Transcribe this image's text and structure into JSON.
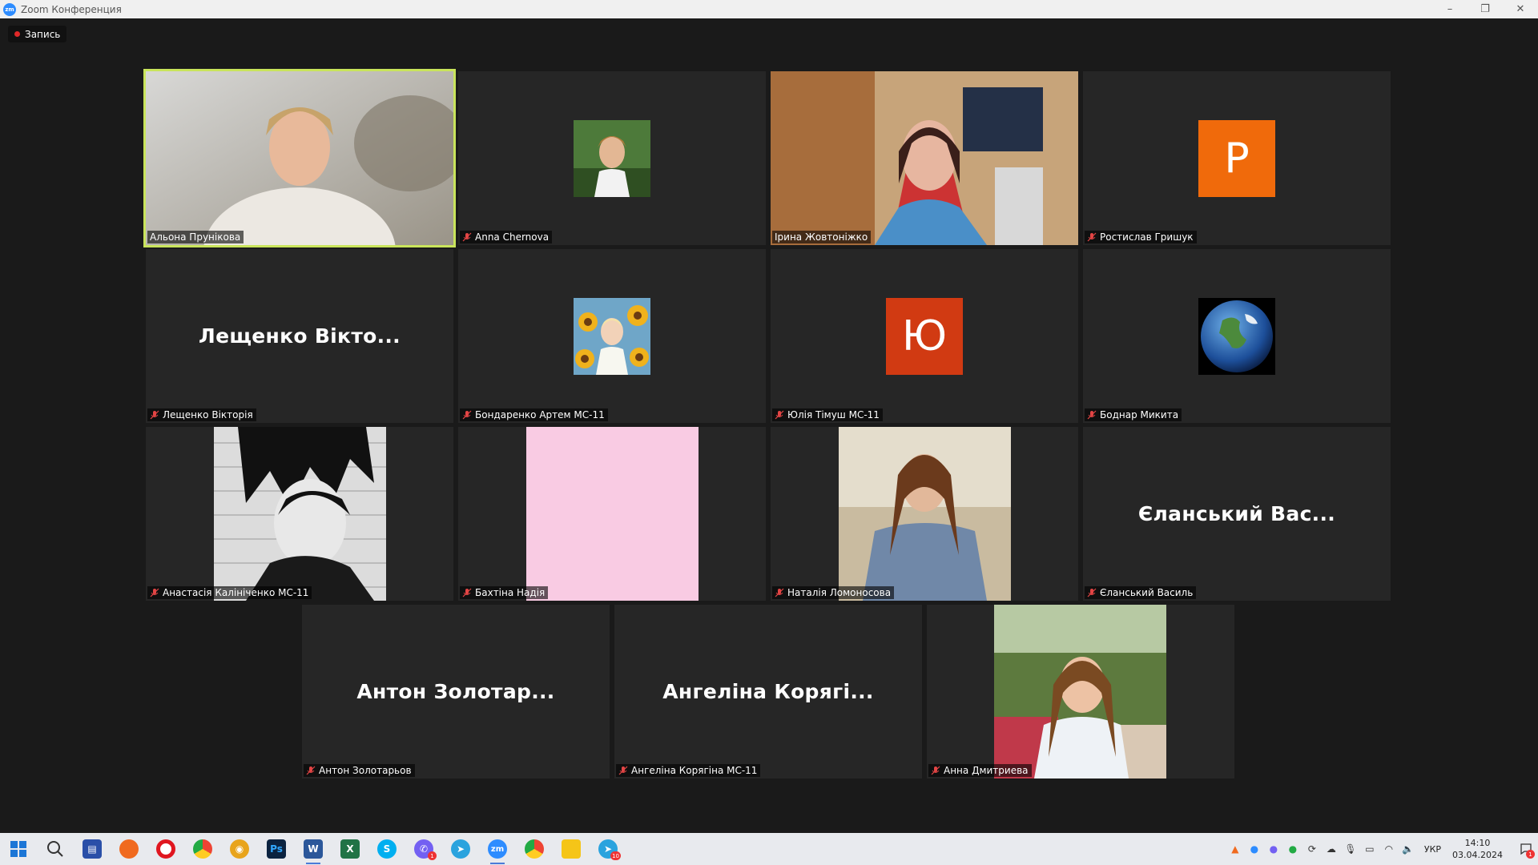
{
  "window": {
    "title": "Zoom Конференция",
    "logo_text": "zm",
    "controls": {
      "minimize": "–",
      "restore": "❐",
      "close": "✕"
    }
  },
  "recording": {
    "label": "Запись",
    "color": "#e02828"
  },
  "participants": [
    {
      "id": "p1",
      "name": "Альона Прунікова",
      "type": "video",
      "active": true,
      "muted": false
    },
    {
      "id": "p2",
      "name": "Anna Chernova",
      "type": "photo",
      "muted": true
    },
    {
      "id": "p3",
      "name": "Ірина Жовтоніжко",
      "type": "video",
      "muted": false
    },
    {
      "id": "p4",
      "name": "Ростислав Гришук",
      "type": "letter",
      "letter": "Р",
      "color": "#f06a0b",
      "muted": true
    },
    {
      "id": "p5",
      "name": "Лещенко Вікторія",
      "center_name": "Лещенко  Вікто...",
      "type": "name",
      "muted": true
    },
    {
      "id": "p6",
      "name": "Бондаренко Артем МС-11",
      "type": "photo",
      "muted": true
    },
    {
      "id": "p7",
      "name": "Юлія Тімуш МС-11",
      "type": "letter",
      "letter": "Ю",
      "color": "#d13a12",
      "muted": true
    },
    {
      "id": "p8",
      "name": "Боднар Микита",
      "type": "photo",
      "muted": true
    },
    {
      "id": "p9",
      "name": "Анастасія Калініченко МС-11",
      "type": "picture",
      "muted": true
    },
    {
      "id": "p10",
      "name": "Бахтіна Надія",
      "type": "picture",
      "color": "#f9cbe3",
      "muted": true
    },
    {
      "id": "p11",
      "name": "Наталія Ломоносова",
      "type": "picture",
      "muted": true
    },
    {
      "id": "p12",
      "name": "Єланський Василь",
      "center_name": "Єланський  Вас...",
      "type": "name",
      "muted": true
    },
    {
      "id": "p13",
      "name": "Антон Золотарьов",
      "center_name": "Антон  Золотар...",
      "type": "name",
      "muted": true
    },
    {
      "id": "p14",
      "name": "Ангеліна Корягіна МС-11",
      "center_name": "Ангеліна  Корягі...",
      "type": "name",
      "muted": true
    },
    {
      "id": "p15",
      "name": "Анна Дмитриева",
      "type": "picture",
      "muted": true
    }
  ],
  "colors": {
    "active_border": "#c9e45b",
    "tile_bg": "#262626",
    "background": "#1a1a1a"
  },
  "taskbar": {
    "apps": [
      {
        "name": "start-icon",
        "label": ""
      },
      {
        "name": "search-icon",
        "label": ""
      },
      {
        "name": "save-app-icon",
        "label": ""
      },
      {
        "name": "firefox-icon",
        "label": ""
      },
      {
        "name": "opera-icon",
        "label": ""
      },
      {
        "name": "chrome-icon",
        "label": ""
      },
      {
        "name": "eye-app-icon",
        "label": ""
      },
      {
        "name": "photoshop-icon",
        "label": "Ps"
      },
      {
        "name": "word-icon",
        "label": "W"
      },
      {
        "name": "excel-icon",
        "label": "X"
      },
      {
        "name": "skype-icon",
        "label": "S"
      },
      {
        "name": "viber-icon",
        "label": "",
        "badge": "1"
      },
      {
        "name": "telegram-icon",
        "label": ""
      },
      {
        "name": "zoom-icon",
        "label": "zm"
      },
      {
        "name": "chrome-2-icon",
        "label": ""
      },
      {
        "name": "file-explorer-icon",
        "label": ""
      },
      {
        "name": "telegram-2-icon",
        "label": "",
        "badge": "10"
      }
    ],
    "language": "УКР",
    "time": "14:10",
    "date": "03.04.2024",
    "notification_count": "1"
  }
}
